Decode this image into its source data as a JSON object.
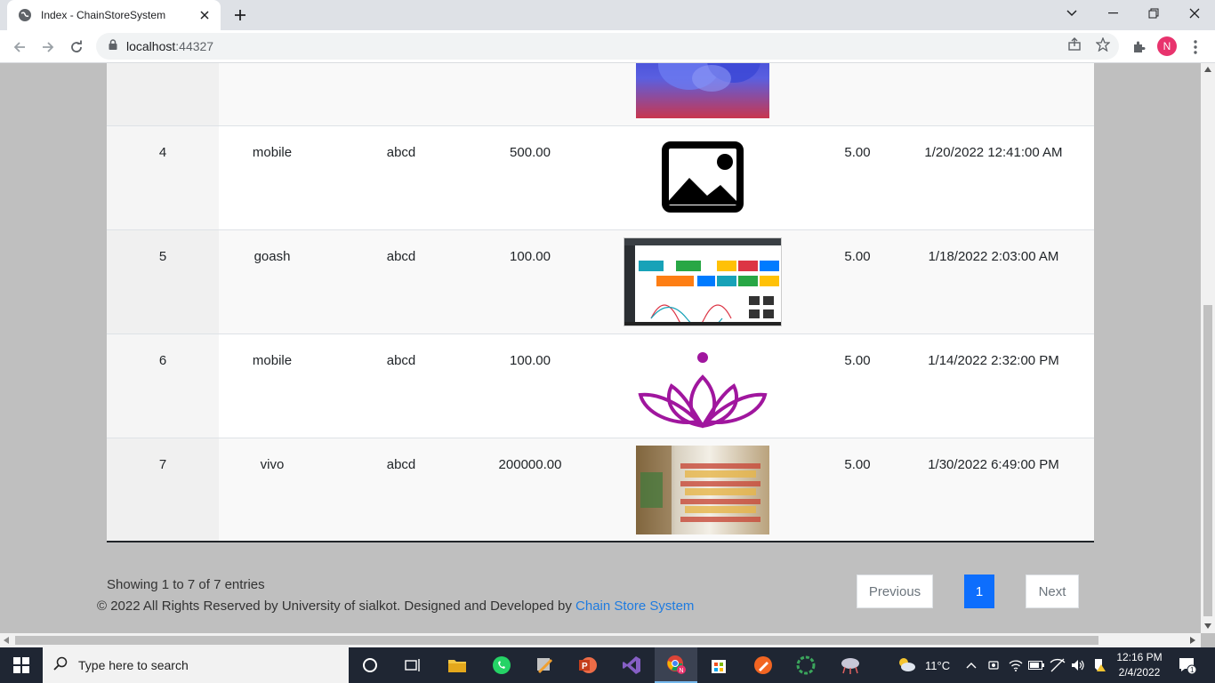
{
  "browser": {
    "tab_title": "Index - ChainStoreSystem",
    "url_host": "localhost",
    "url_port": ":44327",
    "profile_initial": "N"
  },
  "table": {
    "rows": [
      {
        "id": "4",
        "name": "mobile",
        "description": "abcd",
        "price": "500.00",
        "image": "image-placeholder",
        "discount": "5.00",
        "date": "1/20/2022 12:41:00 AM"
      },
      {
        "id": "5",
        "name": "goash",
        "description": "abcd",
        "price": "100.00",
        "image": "dashboard-screenshot",
        "discount": "5.00",
        "date": "1/18/2022 2:03:00 AM"
      },
      {
        "id": "6",
        "name": "mobile",
        "description": "abcd",
        "price": "100.00",
        "image": "lotus-logo",
        "discount": "5.00",
        "date": "1/14/2022 2:32:00 PM"
      },
      {
        "id": "7",
        "name": "vivo",
        "description": "abcd",
        "price": "200000.00",
        "image": "store-shelves-photo",
        "discount": "5.00",
        "date": "1/30/2022 6:49:00 PM"
      }
    ]
  },
  "footer": {
    "showing": "Showing 1 to 7 of 7 entries",
    "copyright": "© 2022 All Rights Reserved by University of sialkot. Designed and Developed by ",
    "link": "Chain Store System"
  },
  "pagination": {
    "previous": "Previous",
    "page": "1",
    "next": "Next"
  },
  "taskbar": {
    "search_placeholder": "Type here to search",
    "temperature": "11°C",
    "time": "12:16 PM",
    "date": "2/4/2022",
    "notification_count": "1"
  }
}
